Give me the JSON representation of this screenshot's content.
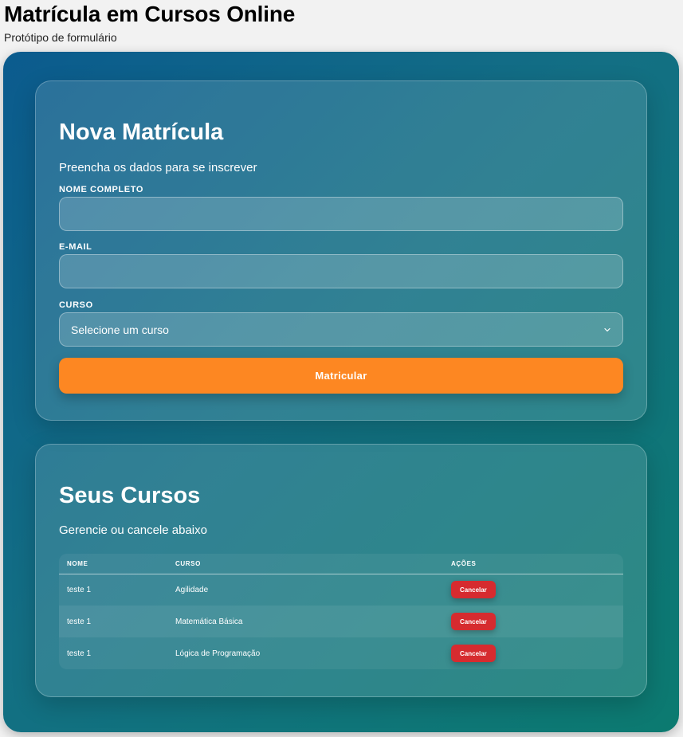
{
  "header": {
    "title": "Matrícula em Cursos Online",
    "subtitle": "Protótipo de formulário"
  },
  "form": {
    "title": "Nova Matrícula",
    "subtitle": "Preencha os dados para se inscrever",
    "name_label": "NOME COMPLETO",
    "name_value": "",
    "email_label": "E-MAIL",
    "email_value": "",
    "course_label": "CURSO",
    "course_selected": "Selecione um curso",
    "submit_label": "Matricular"
  },
  "list": {
    "title": "Seus Cursos",
    "subtitle": "Gerencie ou cancele abaixo",
    "columns": [
      "NOME",
      "CURSO",
      "AÇÕES"
    ],
    "rows": [
      {
        "name": "teste 1",
        "course": "Agilidade",
        "action": "Cancelar"
      },
      {
        "name": "teste 1",
        "course": "Matemática Básica",
        "action": "Cancelar"
      },
      {
        "name": "teste 1",
        "course": "Lógica de Programação",
        "action": "Cancelar"
      }
    ]
  },
  "colors": {
    "accent": "#fd8722",
    "danger": "#d62b2f",
    "gradient_start": "#0b5b8e",
    "gradient_end": "#0c7a70"
  },
  "icons": {
    "select_chevron": "chevron-down-icon"
  }
}
